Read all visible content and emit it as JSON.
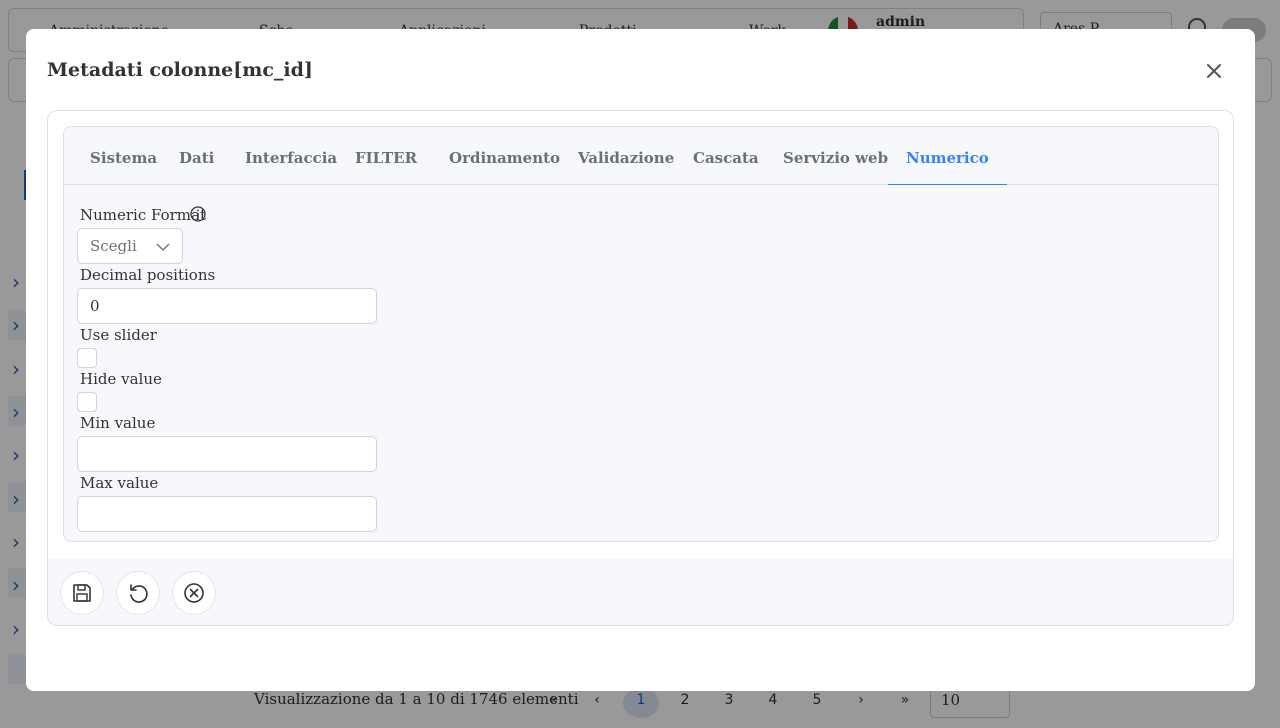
{
  "background": {
    "topbar_items": [
      "Amministrazione",
      "Sche...",
      "Applicazioni",
      "Prodotti",
      "Work..."
    ],
    "user": "admin",
    "right_select": "Ares P...",
    "pager_text": "Visualizzazione da 1 a 10 di 1746 elementi",
    "pages": [
      "1",
      "2",
      "3",
      "4",
      "5"
    ],
    "page_size": "10"
  },
  "modal": {
    "title": "Metadati colonne[mc_id]",
    "tabs": [
      {
        "label": "Sistema"
      },
      {
        "label": "Dati"
      },
      {
        "label": "Interfaccia"
      },
      {
        "label": "FILTER"
      },
      {
        "label": "Ordinamento"
      },
      {
        "label": "Validazione"
      },
      {
        "label": "Cascata"
      },
      {
        "label": "Servizio web"
      },
      {
        "label": "Numerico",
        "active": true
      }
    ],
    "form": {
      "numeric_format": {
        "label": "Numeric Format",
        "value": "Scegli"
      },
      "decimal_positions": {
        "label": "Decimal positions",
        "value": "0"
      },
      "use_slider": {
        "label": "Use slider",
        "checked": false
      },
      "hide_value": {
        "label": "Hide value",
        "checked": false
      },
      "min_value": {
        "label": "Min value",
        "value": ""
      },
      "max_value": {
        "label": "Max value",
        "value": ""
      }
    },
    "footer_buttons": [
      "save-icon",
      "reset-icon",
      "cancel-icon"
    ]
  },
  "colors": {
    "accent": "#3b82f6",
    "tab_text": "#6b6f76",
    "panel_bg": "#f6f8fb",
    "border": "#dcdfe6"
  }
}
